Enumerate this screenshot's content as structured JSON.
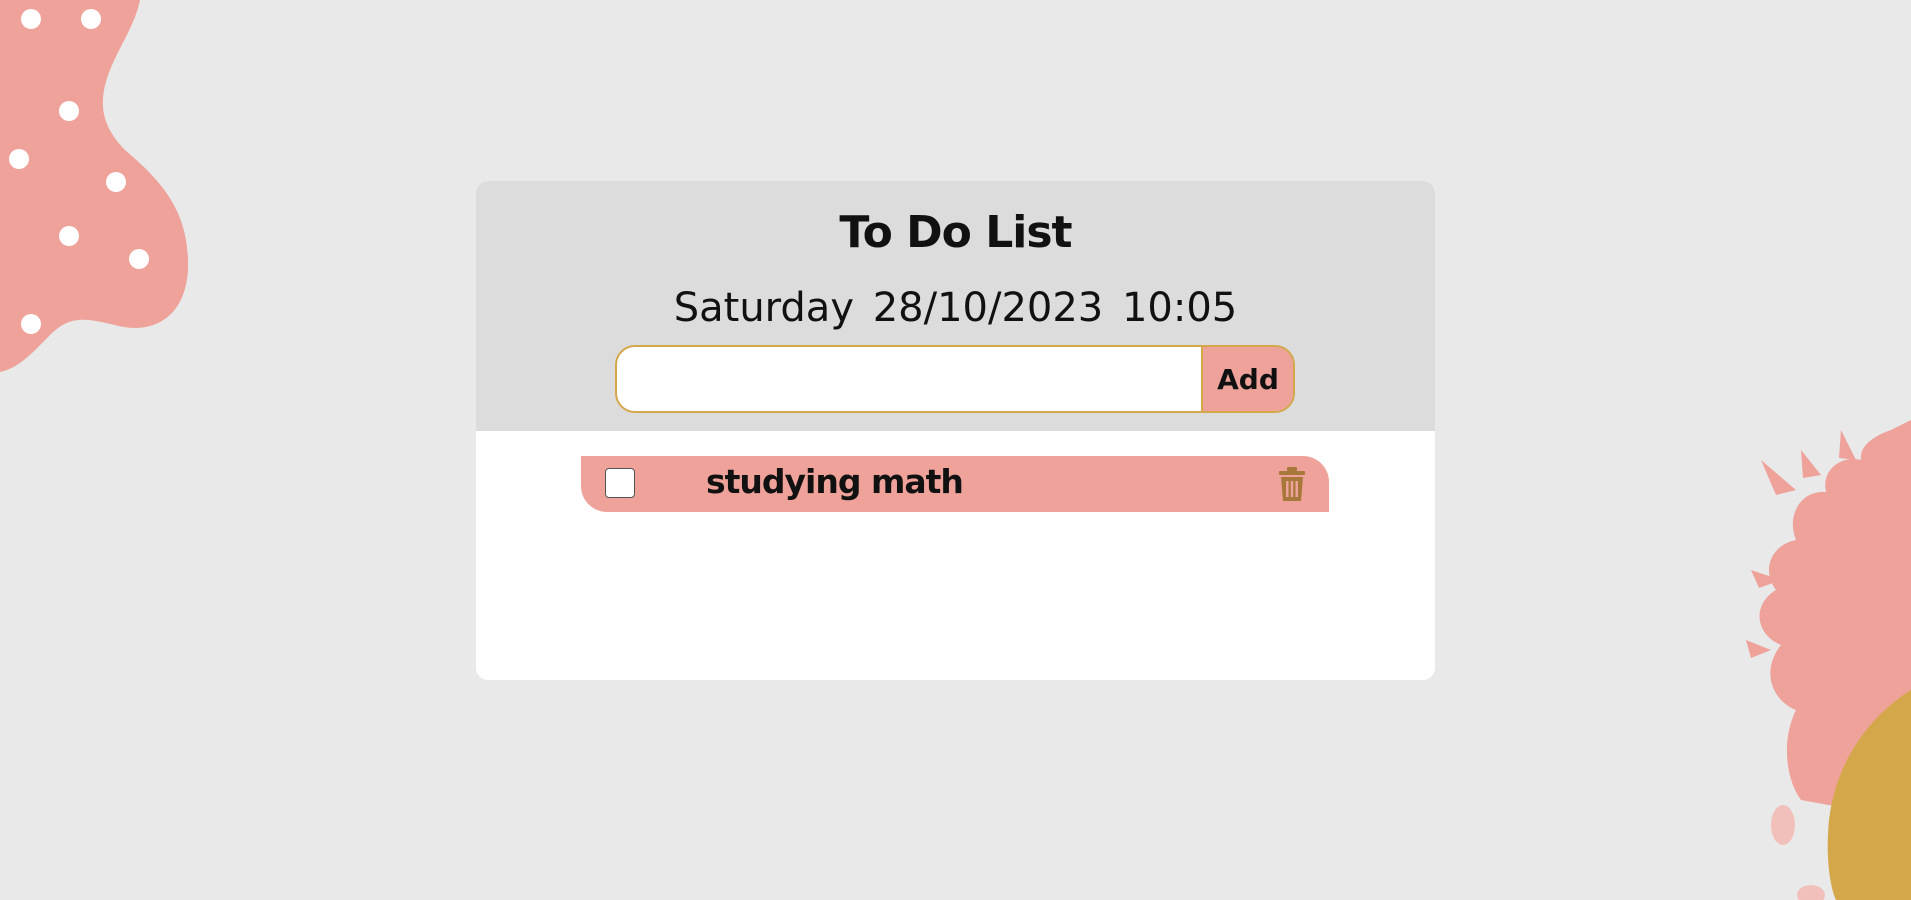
{
  "app": {
    "title": "To Do List",
    "datetime": "Saturday 28/10/2023 10:05"
  },
  "form": {
    "input_value": "",
    "input_placeholder": "",
    "add_label": "Add"
  },
  "tasks": [
    {
      "text": "studying math",
      "checked": false
    }
  ],
  "icons": {
    "delete": "trash-icon",
    "checkbox": "checkbox"
  },
  "colors": {
    "background": "#e9e9e9",
    "header": "#dcdcdc",
    "accent_pink": "#eea29a",
    "accent_gold": "#d4a84a",
    "trash": "#a8783a"
  }
}
